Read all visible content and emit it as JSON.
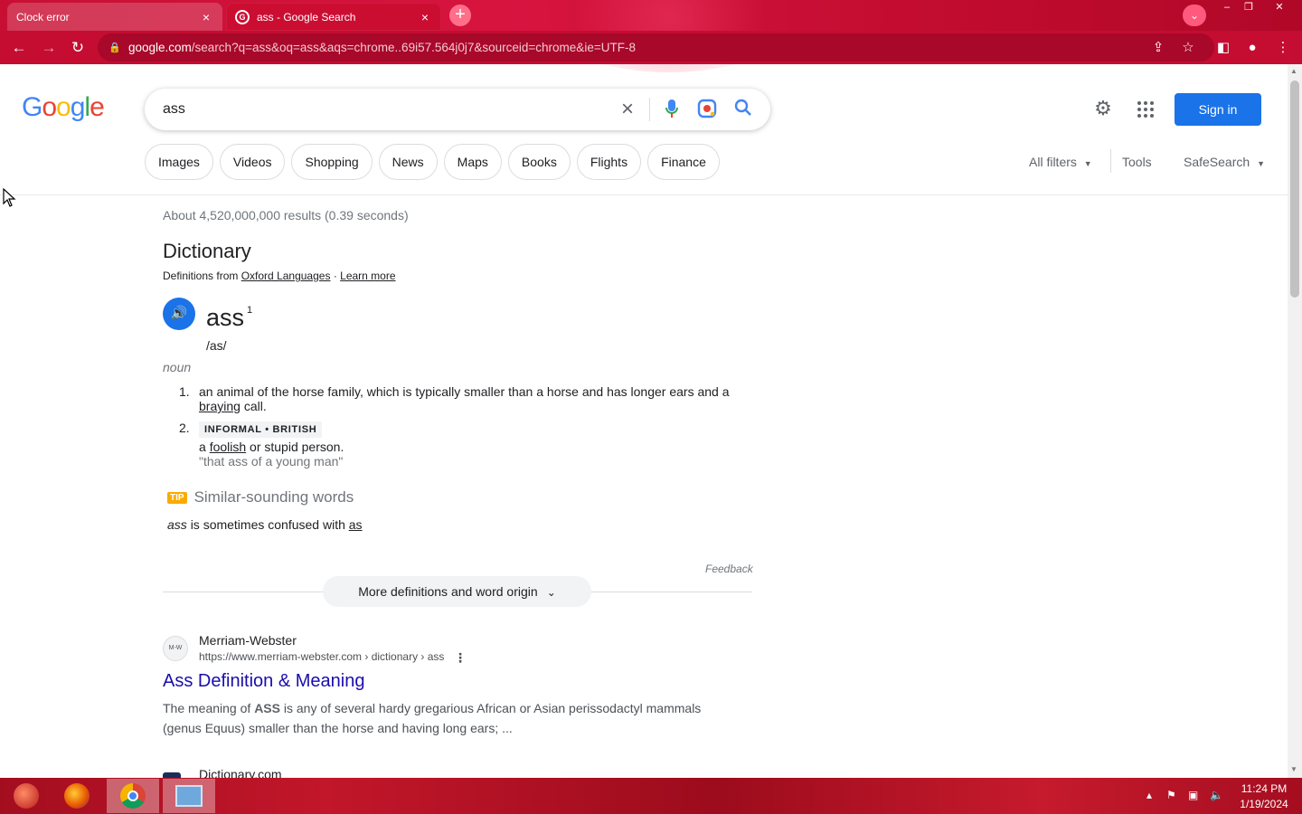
{
  "browser": {
    "tabs": [
      {
        "title": "Clock error",
        "close": "×",
        "active": false
      },
      {
        "title": "ass - Google Search",
        "close": "×",
        "active": true
      }
    ],
    "new_tab": "+",
    "url_host": "google.com",
    "url_rest": "/search?q=ass&oq=ass&aqs=chrome..69i57.564j0j7&sourceid=chrome&ie=UTF-8",
    "accent_color": "#c40d31"
  },
  "search": {
    "query": "ass",
    "clear_icon": "×",
    "voice_icon": "🎤",
    "lens_icon": "◎",
    "search_icon": "🔍"
  },
  "header": {
    "sign_in": "Sign in",
    "settings_icon": "⚙",
    "chips": [
      "Images",
      "Videos",
      "Shopping",
      "News",
      "Maps",
      "Books",
      "Flights",
      "Finance"
    ],
    "all_filters": "All filters",
    "tools": "Tools",
    "safesearch": "SafeSearch"
  },
  "results": {
    "stats": "About 4,520,000,000 results (0.39 seconds)",
    "dictionary": {
      "title": "Dictionary",
      "source_prefix": "Definitions from",
      "source_link": "Oxford Languages",
      "source_sep": "·",
      "learn_more": "Learn more",
      "word": "ass",
      "sup": "1",
      "phonetic": "/as/",
      "pos": "noun",
      "definitions": [
        {
          "num": "1.",
          "text_a": "an animal of the horse family, which is typically smaller than a horse and has longer ears and a",
          "link": "braying",
          "text_b": "call."
        },
        {
          "num": "2.",
          "tag": "INFORMAL • BRITISH",
          "text_a": "a",
          "link": "foolish",
          "text_b": "or stupid person.",
          "example": "\"that ass of a young man\""
        }
      ],
      "tip_badge": "TIP",
      "tip_heading": "Similar-sounding words",
      "confused_word": "ass",
      "confused_text": "is sometimes confused with",
      "confused_link": "as",
      "feedback": "Feedback",
      "more": "More definitions and word origin"
    },
    "items": [
      {
        "site": "Merriam-Webster",
        "favicon_text": "M-W",
        "url": "https://www.merriam-webster.com › dictionary › ass",
        "title": "Ass Definition & Meaning",
        "snippet_a": "The meaning of",
        "snippet_bold": "ASS",
        "snippet_b": "is any of several hardy gregarious African or Asian perissodactyl mammals (genus Equus) smaller than the horse and having long ears; ..."
      },
      {
        "site": "Dictionary.com",
        "favicon_text": "D"
      }
    ]
  },
  "taskbar": {
    "time": "11:24 PM",
    "date": "1/19/2024"
  }
}
